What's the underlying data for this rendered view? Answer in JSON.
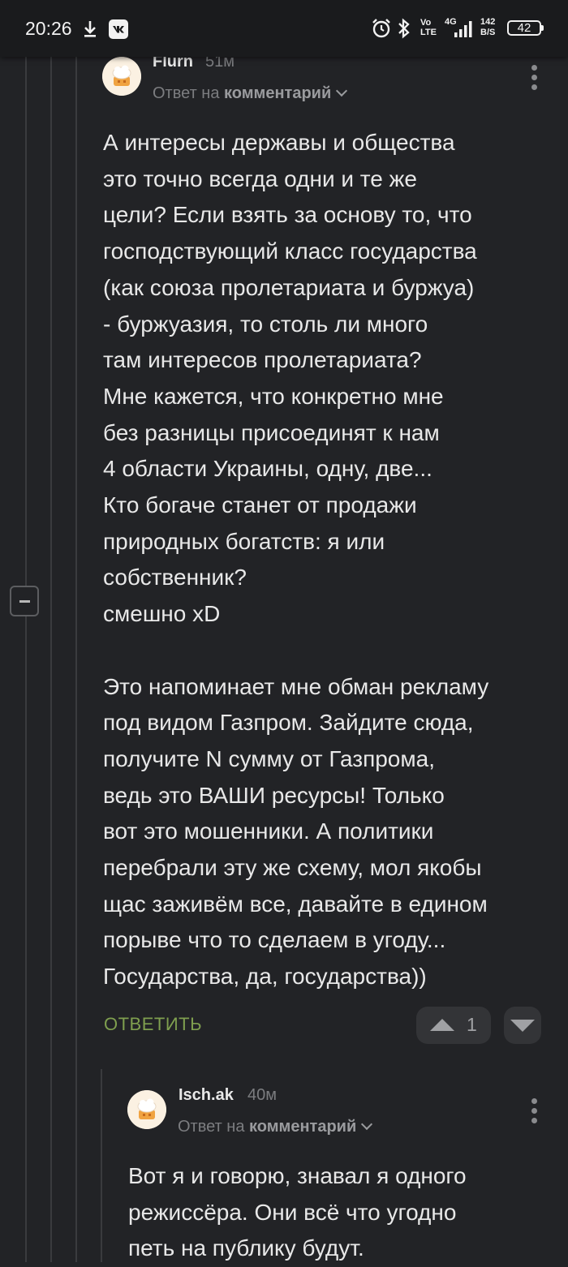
{
  "status_bar": {
    "time": "20:26",
    "network_speed_value": "142",
    "network_speed_unit": "B/S",
    "battery": "42",
    "icons": [
      "download-icon",
      "vk-icon",
      "alarm-icon",
      "bluetooth-icon",
      "volte-icon",
      "signal-4g-icon",
      "battery-icon"
    ],
    "volte_label": "Vo\nLTE",
    "network_label": "4G"
  },
  "comments": [
    {
      "username": "Flurn",
      "time": "51м",
      "reply_prefix": "Ответ на",
      "reply_target": "комментарий",
      "text": "А интересы державы и общества\nэто точно всегда одни и те же\nцели? Если взять за основу то, что\nгосподствующий класс государства\n(как союза пролетариата и буржуа)\n- буржуазия, то столь ли много\nтам интересов пролетариата?\nМне кажется, что конкретно мне\nбез разницы присоединят к нам\n4 области Украины, одну, две...\nКто богаче станет от продажи\nприродных богатств: я или\nсобственник?\nсмешно xD\n\nЭто напоминает мне обман рекламу\nпод видом Газпром. Зайдите сюда,\nполучите N сумму от Газпрома,\nведь это ВАШИ ресурсы! Только\nвот это мошенники. А политики\nперебрали эту же схему, мол якобы\nщас заживём все, давайте в едином\nпорыве что то сделаем в угоду...\nГосударства, да, государства))",
      "reply_label": "ОТВЕТИТЬ",
      "rating": "1"
    },
    {
      "username": "Isch.ak",
      "time": "40м",
      "reply_prefix": "Ответ на",
      "reply_target": "комментарий",
      "text": "Вот я и говорю, знавал я одного\nрежиссёра. Они всё что угодно\nпеть на публику будут."
    }
  ]
}
